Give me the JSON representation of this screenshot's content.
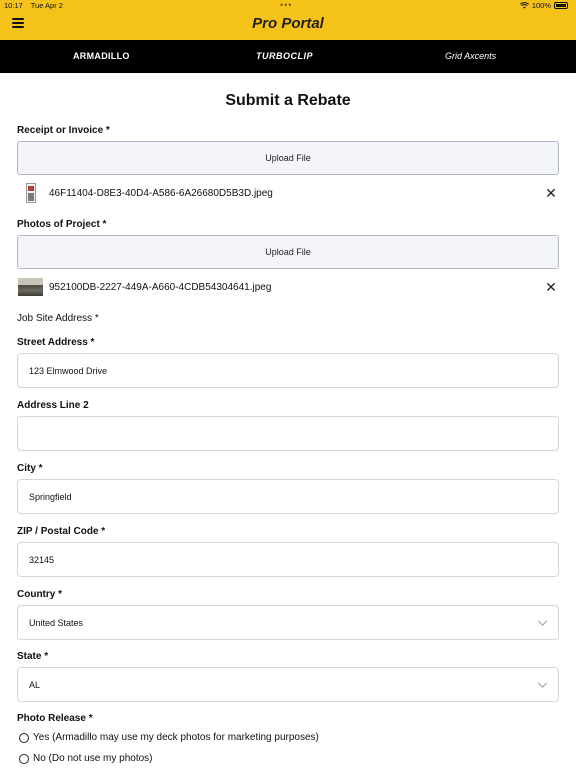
{
  "status_bar": {
    "time": "10:17",
    "date": "Tue Apr 2",
    "battery": "100%"
  },
  "header": {
    "title": "Pro Portal"
  },
  "brands": [
    "ARMADILLO",
    "TURBOCLIP",
    "Grid Axcents"
  ],
  "form": {
    "title": "Submit a Rebate",
    "receipt": {
      "label": "Receipt or Invoice *",
      "upload_label": "Upload File",
      "file_name": "46F11404-D8E3-40D4-A586-6A26680D5B3D.jpeg"
    },
    "photos": {
      "label": "Photos of Project *",
      "upload_label": "Upload File",
      "file_name": "952100DB-2227-449A-A660-4CDB54304641.jpeg"
    },
    "job_site_label": "Job Site Address *",
    "street": {
      "label": "Street Address *",
      "value": "123 Elmwood Drive"
    },
    "address2": {
      "label": "Address Line 2",
      "value": ""
    },
    "city": {
      "label": "City *",
      "value": "Springfield"
    },
    "zip": {
      "label": "ZIP / Postal Code *",
      "value": "32145"
    },
    "country": {
      "label": "Country *",
      "value": "United States"
    },
    "state": {
      "label": "State *",
      "value": "AL"
    },
    "photo_release": {
      "label": "Photo Release *",
      "options": [
        "Yes (Armadillo may use my deck photos for marketing purposes)",
        "No (Do not use my photos)"
      ]
    }
  },
  "icons": {
    "menu": "hamburger-menu-icon",
    "remove": "close-x-icon",
    "dropdown": "chevron-down-icon"
  },
  "colors": {
    "header_bg": "#f5c21a",
    "brand_bar_bg": "#000000"
  }
}
